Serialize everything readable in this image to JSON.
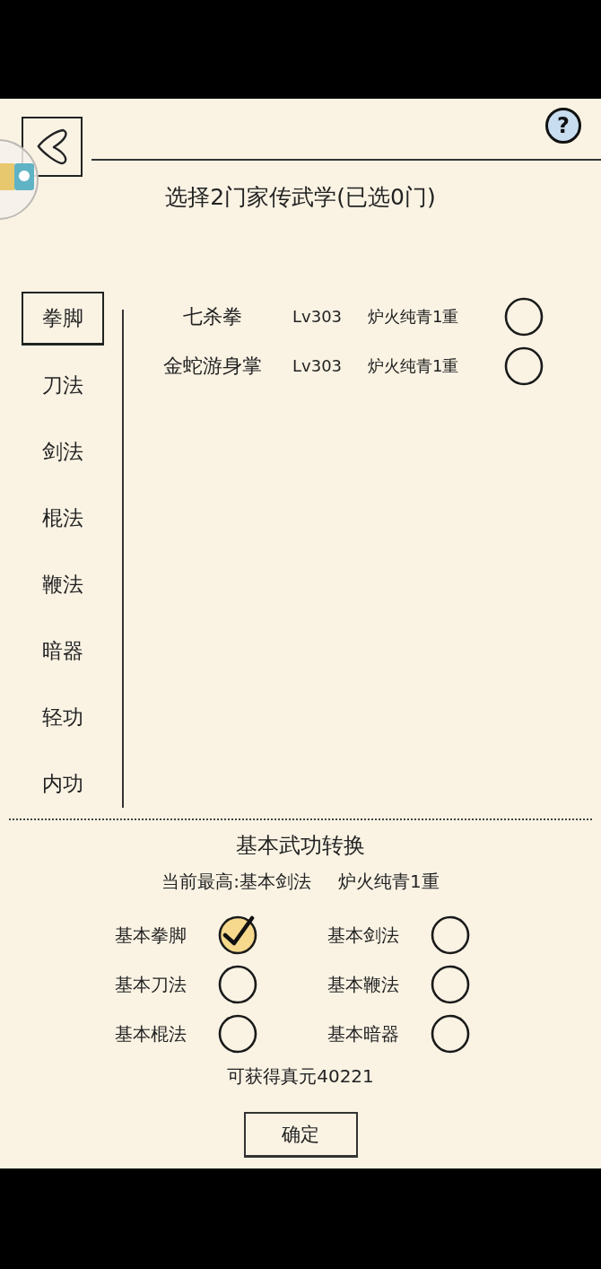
{
  "header": {
    "help_label": "?"
  },
  "title": "选择2门家传武学(已选0门)",
  "categories": [
    {
      "label": "拳脚",
      "selected": true
    },
    {
      "label": "刀法",
      "selected": false
    },
    {
      "label": "剑法",
      "selected": false
    },
    {
      "label": "棍法",
      "selected": false
    },
    {
      "label": "鞭法",
      "selected": false
    },
    {
      "label": "暗器",
      "selected": false
    },
    {
      "label": "轻功",
      "selected": false
    },
    {
      "label": "内功",
      "selected": false
    }
  ],
  "skills": [
    {
      "name": "七杀拳",
      "rank": "Lv303",
      "realm": "炉火纯青1重",
      "selected": false
    },
    {
      "name": "金蛇游身掌",
      "rank": "Lv303",
      "realm": "炉火纯青1重",
      "selected": false
    }
  ],
  "conversion": {
    "title": "基本武功转换",
    "current_best": "当前最高:基本剑法",
    "current_realm": "炉火纯青1重",
    "options": [
      {
        "label": "基本拳脚",
        "selected": true
      },
      {
        "label": "基本剑法",
        "selected": false
      },
      {
        "label": "基本刀法",
        "selected": false
      },
      {
        "label": "基本鞭法",
        "selected": false
      },
      {
        "label": "基本棍法",
        "selected": false
      },
      {
        "label": "基本暗器",
        "selected": false
      }
    ],
    "reward": "可获得真元40221",
    "confirm": "确定"
  }
}
